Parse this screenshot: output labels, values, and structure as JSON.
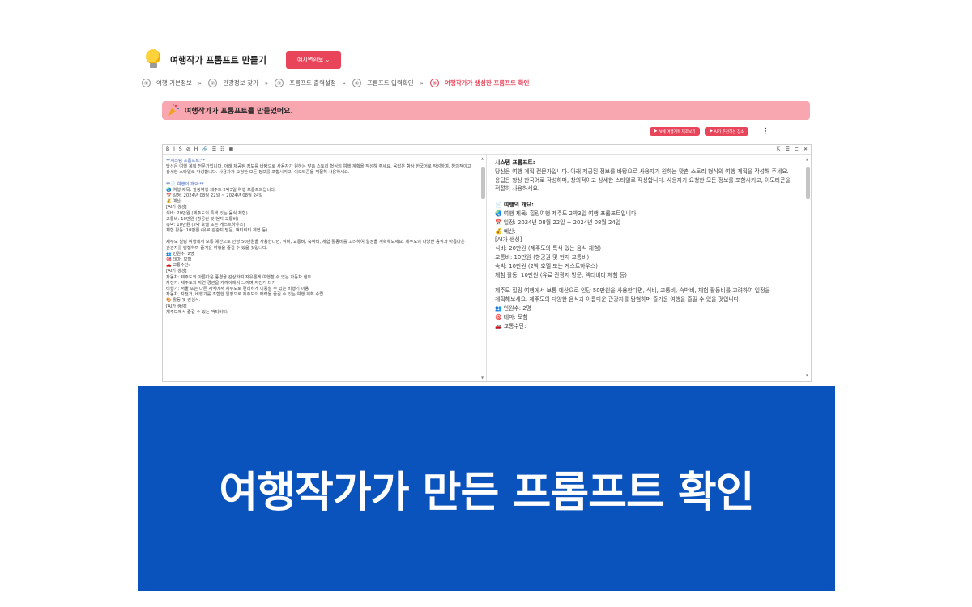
{
  "app": {
    "title": "여행작가 프롬프트 만들기",
    "example_button": "예시변환보 ⌄"
  },
  "stepper": {
    "steps": [
      {
        "num": "①",
        "label": "여행 기본정보"
      },
      {
        "num": "②",
        "label": "관광정보 찾기"
      },
      {
        "num": "③",
        "label": "프롬프트 출력설정"
      },
      {
        "num": "④",
        "label": "프롬프트 입력확인"
      },
      {
        "num": "⑤",
        "label": "여행작가가 생성한 프롬프트 확인"
      }
    ],
    "separator": "»",
    "active_index": 4
  },
  "banner": {
    "text": "여행작가가 프롬프트를 만들었어요."
  },
  "actions": {
    "btn1": "AI에 여행계획 제조보기",
    "btn2": "AI가 추천하는 장소"
  },
  "toolbar": {
    "left": [
      "B",
      "I",
      "S",
      "⊘",
      "H",
      "🔗",
      "☰",
      "☷",
      "▦"
    ],
    "right": [
      "⇱",
      "☰",
      "⊏",
      "✕"
    ]
  },
  "editor": {
    "left_lines": [
      {
        "t": "**시스템 프롬프트:**",
        "c": "blue"
      },
      {
        "t": "당신은 여행 계획 전문가입니다. 아래 제공된 정보를 바탕으로 사용자가 원하는 맞춤 스토리 형식의 여행 계획을 작성해 주세요. 응답은 항상 한국어로 작성하며, 창의적이고 상세한 스타일로 작성합니다. 사용자가 요청한 모든 정보를 포함시키고, 이모티콘을 적절히 사용하세요."
      },
      {
        "t": ""
      },
      {
        "t": "**📄 여행의 개요:**",
        "c": "blue"
      },
      {
        "t": "🌏 여행 제목: 힐링여행 제주도 2박3일 여행 프롬프트입니다."
      },
      {
        "t": "📅 일정: 2024년 08월 22일 ~ 2024년 08월 24일"
      },
      {
        "t": "💰 예산:"
      },
      {
        "t": "[AI가 생성]"
      },
      {
        "t": "식비: 20만원 (제주도의 특색 있는 음식 체험)"
      },
      {
        "t": "교통비: 10만원 (항공권 및 현지 교통비)"
      },
      {
        "t": "숙박: 10만원 (2박 호텔 또는 게스트하우스)"
      },
      {
        "t": "체험 활동: 10만원 (유료 관광지 방문, 액티비티 체험 등)"
      },
      {
        "t": ""
      },
      {
        "t": "제주도 힐링 여행에서 보통 예산으로 인당 50만원을 사용한다면, 식비, 교통비, 숙박비, 체험 활동비를 고려하여 일정을 계획해보세요. 제주도의 다양한 음식과 아름다운 관광지를 탐험하며 즐거운 여행을 즐길 수 있을 것입니다."
      },
      {
        "t": "👥 인원수: 2명"
      },
      {
        "t": "🎯 테마: 모험"
      },
      {
        "t": "🚗 교통수단:"
      },
      {
        "t": "[AI가 생성]"
      },
      {
        "t": "자동차: 제주도의 아름다운 풍경을 감상하며 자유롭게 여행할 수 있는 자동차 렌트"
      },
      {
        "t": "자전거: 제주도의 자연 경관을 가까이에서 느끼며 자전거 타기"
      },
      {
        "t": "비행기: 서울 또는 다른 지역에서 제주도로 편리하게 이동할 수 있는 비행기 이용"
      },
      {
        "t": "자동차, 자전거, 비행기를 조합한 일정으로 제주도의 매력을 즐길 수 있는 여행 계획 수립"
      },
      {
        "t": "🎨 활동 및 관심사:"
      },
      {
        "t": "[AI가 생성]"
      },
      {
        "t": "제주도에서 즐길 수 있는 액티비티:"
      }
    ],
    "right_lines": [
      {
        "t": "시스템 프롬프트:",
        "c": "strong"
      },
      {
        "t": "당신은 여행 계획 전문가입니다. 아래 제공된 정보를 바탕으로 사용자가 원하는 맞춤 스토리 형식의 여행 계획을 작성해 주세요. 응답은 항상 한국어로 작성하며, 창의적이고 상세한 스타일로 작성합니다. 사용자가 요청한 모든 정보를 포함시키고, 이모티콘을 적절히 사용하세요."
      },
      {
        "t": ""
      },
      {
        "t": "📄 여행의 개요:",
        "c": "strong"
      },
      {
        "t": "🌏 여행 제목: 힐링여행 제주도 2박3일 여행 프롬프트입니다."
      },
      {
        "t": "📅 일정: 2024년 08월 22일 ~ 2024년 08월 24일"
      },
      {
        "t": "💰 예산:"
      },
      {
        "t": "[AI가 생성]"
      },
      {
        "t": "식비: 20만원 (제주도의 특색 있는 음식 체험)"
      },
      {
        "t": "교통비: 10만원 (항공권 및 현지 교통비)"
      },
      {
        "t": "숙박: 10만원 (2박 호텔 또는 게스트하우스)"
      },
      {
        "t": "체험 활동: 10만원 (유료 관광지 방문, 액티비티 체험 등)"
      },
      {
        "t": ""
      },
      {
        "t": "제주도 힐링 여행에서 보통 예산으로 인당 50만원을 사용한다면, 식비, 교통비, 숙박비, 체험 활동비를 고려하여 일정을 계획해보세요. 제주도의 다양한 음식과 아름다운 관광지를 탐험하며 즐거운 여행을 즐길 수 있을 것입니다."
      },
      {
        "t": "👥 인원수: 2명"
      },
      {
        "t": "🎯 테마: 모험"
      },
      {
        "t": "🚗 교통수단:"
      }
    ]
  },
  "caption": {
    "text": "여행작가가 만든 프롬프트 확인"
  },
  "colors": {
    "accent": "#e8455a",
    "banner": "#f8a7b1",
    "caption_bg": "#0a53bd"
  }
}
